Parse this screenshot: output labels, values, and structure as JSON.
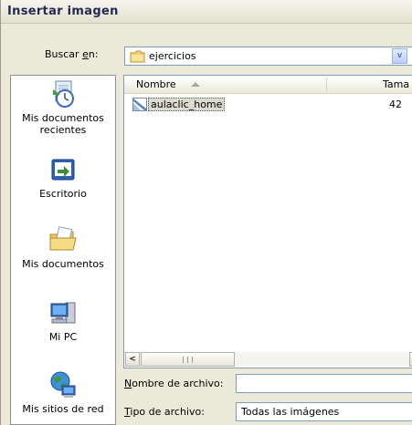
{
  "dialog": {
    "title": "Insertar imagen"
  },
  "look_in": {
    "label_prefix": "Buscar ",
    "label_hotkey": "e",
    "label_suffix": "n:",
    "value": "ejercicios",
    "dropdown_glyph": "v"
  },
  "places": [
    {
      "label": "Mis documentos recientes",
      "icon": "recent-documents-icon"
    },
    {
      "label": "Escritorio",
      "icon": "desktop-icon"
    },
    {
      "label": "Mis documentos",
      "icon": "my-documents-folder-icon"
    },
    {
      "label": "Mi PC",
      "icon": "my-computer-icon"
    },
    {
      "label": "Mis sitios de red",
      "icon": "network-places-icon"
    }
  ],
  "file_list": {
    "columns": {
      "name": "Nombre",
      "size": "Tama"
    },
    "files": [
      {
        "name": "aulaclic_home",
        "size": "42",
        "icon": "image-file-icon"
      }
    ],
    "scroll_left": "<",
    "scroll_right": ">"
  },
  "file_name": {
    "label_hotkey": "N",
    "label_rest": "ombre de archivo:",
    "value": ""
  },
  "file_type": {
    "label_hotkey": "T",
    "label_rest": "ipo de archivo:",
    "value": "Todas las imágenes"
  }
}
